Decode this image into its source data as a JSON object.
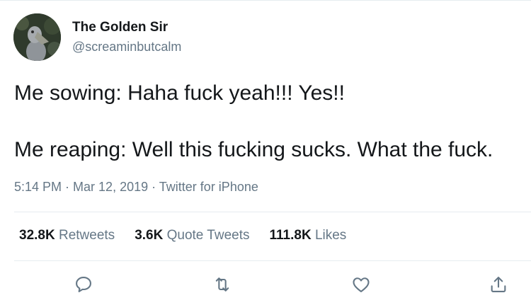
{
  "tweet": {
    "author_name": "The Golden Sir",
    "author_handle": "@screaminbutcalm",
    "text_line_1": "Me sowing: Haha fuck yeah!!! Yes!!",
    "text_line_2": "Me reaping: Well this fucking sucks. What the fuck.",
    "time": "5:14 PM",
    "date": "Mar 12, 2019",
    "source": "Twitter for iPhone",
    "separator": " · "
  },
  "stats": {
    "retweets_count": "32.8K",
    "retweets_label": " Retweets",
    "quotes_count": "3.6K",
    "quotes_label": " Quote Tweets",
    "likes_count": "111.8K",
    "likes_label": " Likes"
  },
  "icons": {
    "reply": "reply-icon",
    "retweet": "retweet-icon",
    "like": "like-icon",
    "share": "share-icon"
  },
  "colors": {
    "secondary_text": "#657786",
    "primary_text": "#14171a",
    "divider": "#e6ecf0"
  }
}
